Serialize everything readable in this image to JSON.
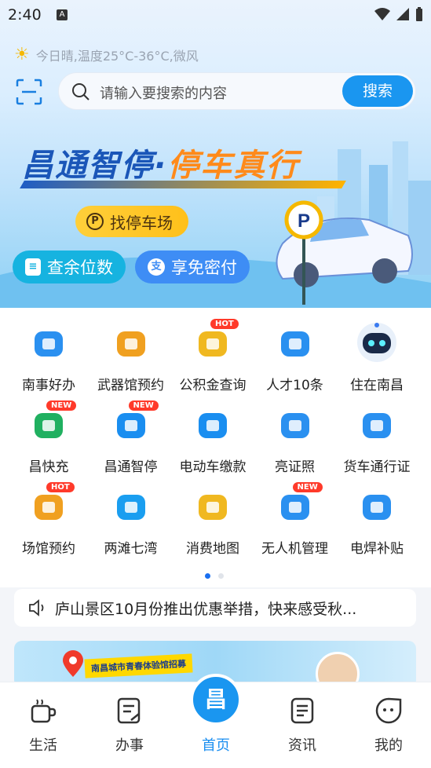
{
  "status_bar": {
    "time": "2:40",
    "a_glyph": "A"
  },
  "weather": {
    "icon": "sun-icon",
    "text": "今日晴,温度25°C-36°C,微风"
  },
  "search": {
    "placeholder": "请输入要搜索的内容",
    "button_label": "搜索"
  },
  "banner": {
    "title_part1": "昌通智停·",
    "title_part2": "停车真行",
    "parking_sign": "P",
    "find_parking": "找停车场",
    "remaining_spots": "查余位数",
    "password_free_pay": "享免密付"
  },
  "services": [
    {
      "label": "南事好办",
      "icon": "compass-icon"
    },
    {
      "label": "武器馆预约",
      "icon": "ticket-icon"
    },
    {
      "label": "公积金查询",
      "icon": "money-bag-icon",
      "badge": "HOT"
    },
    {
      "label": "人才10条",
      "icon": "person-icon"
    },
    {
      "label": "住在南昌",
      "icon": "robot-icon"
    },
    {
      "label": "昌快充",
      "icon": "charger-icon",
      "badge": "NEW"
    },
    {
      "label": "昌通智停",
      "icon": "parking-icon",
      "badge": "NEW"
    },
    {
      "label": "电动车缴款",
      "icon": "scooter-icon"
    },
    {
      "label": "亮证照",
      "icon": "id-card-icon"
    },
    {
      "label": "货车通行证",
      "icon": "truck-icon"
    },
    {
      "label": "场馆预约",
      "icon": "calendar-icon",
      "badge": "HOT"
    },
    {
      "label": "两滩七湾",
      "icon": "swim-icon"
    },
    {
      "label": "消费地图",
      "icon": "coins-icon"
    },
    {
      "label": "无人机管理",
      "icon": "drone-icon",
      "badge": "NEW"
    },
    {
      "label": "电焊补贴",
      "icon": "welder-icon"
    }
  ],
  "notice": {
    "text": "庐山景区10月份推出优惠举措，快来感受秋..."
  },
  "promo": {
    "tag": "南昌城市青春体验馆招募"
  },
  "tabs": [
    {
      "label": "生活",
      "icon": "coffee-cup-icon"
    },
    {
      "label": "办事",
      "icon": "document-edit-icon"
    },
    {
      "label": "首页",
      "icon": "home-logo-icon",
      "active": true,
      "logo_char": "昌"
    },
    {
      "label": "资讯",
      "icon": "news-icon"
    },
    {
      "label": "我的",
      "icon": "smile-face-icon"
    }
  ],
  "colors": {
    "accent": "#1a96f0",
    "hot_badge": "#ff3a2a",
    "banner_yellow": "#ffc01a"
  }
}
